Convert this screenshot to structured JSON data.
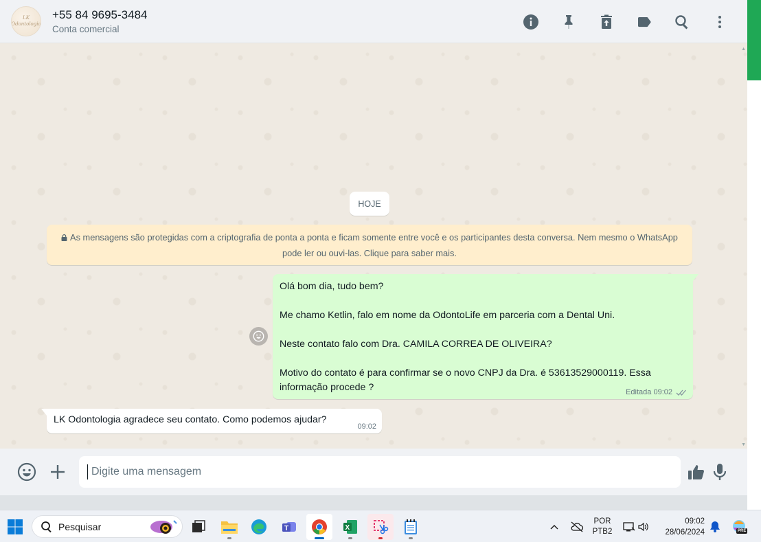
{
  "header": {
    "avatar_text": "LK Odontologia",
    "title": "+55 84 9695-3484",
    "subtitle": "Conta comercial",
    "icons": [
      "info-icon",
      "pin-icon",
      "delete-icon",
      "label-icon",
      "search-icon",
      "menu-icon"
    ]
  },
  "chat": {
    "date_chip": "HOJE",
    "encryption_notice": "As mensagens são protegidas com a criptografia de ponta a ponta e ficam somente entre você e os participantes desta conversa. Nem mesmo o WhatsApp pode ler ou ouvi-las. Clique para saber mais.",
    "outgoing": {
      "lines": [
        "Olá bom dia, tudo bem?",
        "Me chamo Ketlin, falo em nome da OdontoLife em parceria com a Dental Uni.",
        "Neste contato falo com Dra. CAMILA CORREA DE OLIVEIRA?",
        "Motivo do contato é para confirmar se o novo CNPJ da Dra. é 53613529000119. Essa informação procede ?"
      ],
      "status": "Editada",
      "time": "09:02"
    },
    "incoming": {
      "text": "LK Odontologia agradece seu contato. Como podemos ajudar?",
      "time": "09:02"
    }
  },
  "composer": {
    "placeholder": "Digite uma mensagem"
  },
  "taskbar": {
    "search_label": "Pesquisar",
    "lang_top": "POR",
    "lang_bottom": "PTB2",
    "time": "09:02",
    "date": "28/06/2024",
    "copilot_badge": "PRE"
  },
  "colors": {
    "accent": "#1fa855",
    "outgoing_bubble": "#d9fdd3",
    "notice_bg": "#ffeecd"
  }
}
